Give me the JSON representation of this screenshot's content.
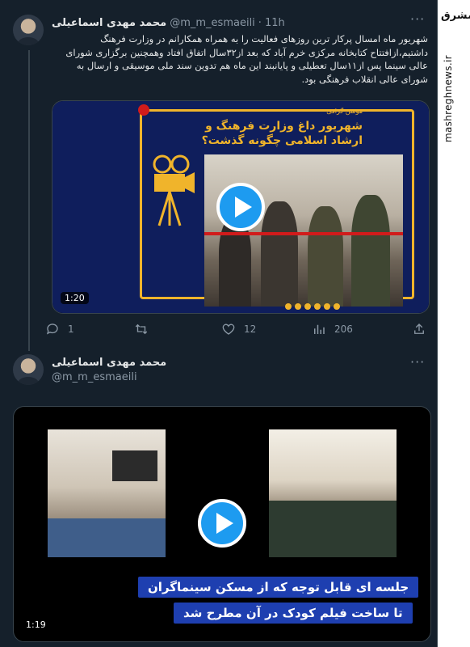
{
  "watermark": {
    "logo": "مشرق",
    "site": "mashreghnews.ir"
  },
  "tweet1": {
    "name": "محمد مهدی اسماعیلی",
    "handle": "@m_m_esmaeili",
    "dot": "·",
    "time": "11h",
    "text": "شهریور ماه امسال پرکار ترین روزهای فعالیت را به همراه همکارانم در وزارت فرهنگ داشتیم،ازافتتاح کتابخانه مرکزی خرم آباد که بعد از۳۲سال اتفاق افتاد وهمچنین برگزاری شورای عالی سینما پس از۱۱سال تعطیلی و پایانبند این ماه هم تدوین سند ملی موسیقی و ارسال به شورای عالی انقلاب فرهنگی بود.",
    "video": {
      "kicker": "موشن گرافی",
      "title": "شهریور داغ وزارت فرهنگ و ارشاد اسلامی چگونه گذشت؟",
      "duration": "1:20"
    },
    "actions": {
      "reply_count": "1",
      "retweet_count": "",
      "like_count": "12",
      "views_count": "206"
    }
  },
  "tweet2": {
    "name": "محمد مهدی اسماعیلی",
    "handle": "@m_m_esmaeili",
    "video": {
      "caption_line1": "جلسه ای قابل توجه که از مسکن سینماگران",
      "caption_line2": "تا ساخت فیلم کودک در آن مطرح شد",
      "duration": "1:19"
    }
  },
  "colors": {
    "background": "#15202b",
    "accent": "#1d9bf0",
    "muted": "#8b98a5",
    "caption_bg": "#1e3fb0",
    "video_frame": "#f0b42b"
  }
}
